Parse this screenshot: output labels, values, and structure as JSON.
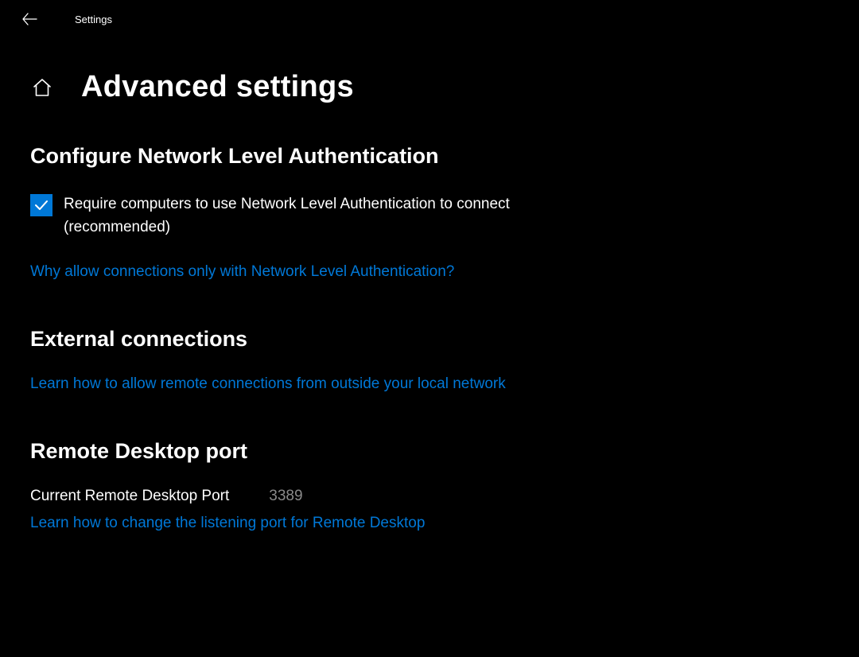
{
  "header": {
    "window_title": "Settings",
    "page_title": "Advanced settings"
  },
  "sections": {
    "nla": {
      "title": "Configure Network Level Authentication",
      "checkbox_label": "Require computers to use Network Level Authentication to connect (recommended)",
      "checkbox_checked": true,
      "help_link": "Why allow connections only with Network Level Authentication?"
    },
    "external": {
      "title": "External connections",
      "help_link": "Learn how to allow remote connections from outside your local network"
    },
    "port": {
      "title": "Remote Desktop port",
      "current_label": "Current Remote Desktop Port",
      "current_value": "3389",
      "help_link": "Learn how to change the listening port for Remote Desktop"
    }
  }
}
